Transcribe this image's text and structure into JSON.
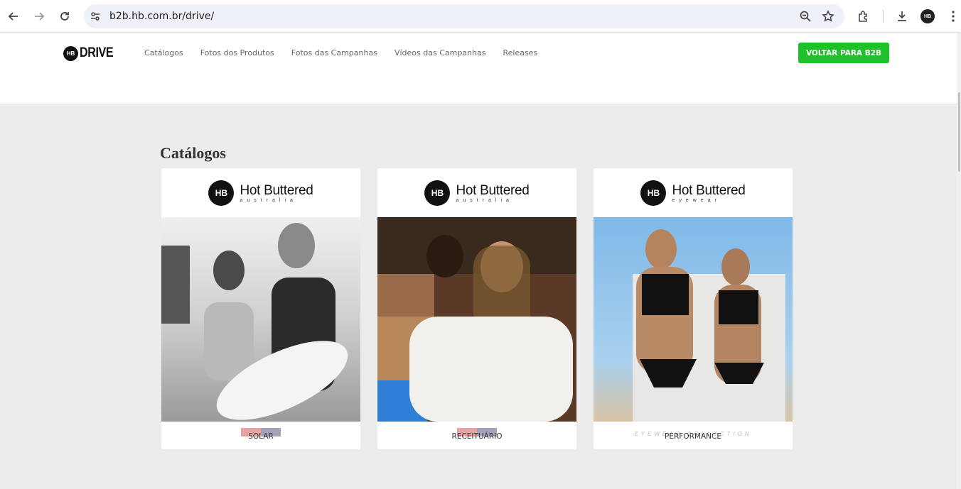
{
  "browser": {
    "url": "b2b.hb.com.br/drive/"
  },
  "header": {
    "logo_badge": "HB",
    "logo_text": "DRIVE",
    "menu": [
      {
        "label": "Catálogos"
      },
      {
        "label": "Fotos dos Produtos"
      },
      {
        "label": "Fotos das Campanhas"
      },
      {
        "label": "Vídeos das Campanhas"
      },
      {
        "label": "Releases"
      }
    ],
    "cta_label": "VOLTAR PARA B2B"
  },
  "main": {
    "section_title": "Catálogos",
    "cards": [
      {
        "brand_badge": "HB",
        "brand": "Hot Buttered",
        "brand_sub": "australia",
        "caption": "SOLAR",
        "photo_style": "bw"
      },
      {
        "brand_badge": "HB",
        "brand": "Hot Buttered",
        "brand_sub": "australia",
        "caption": "RECEITUÁRIO",
        "photo_style": "warm"
      },
      {
        "brand_badge": "HB",
        "brand": "Hot Buttered",
        "brand_sub": "eyewear",
        "caption": "PERFORMANCE",
        "photo_style": "sky",
        "overlay_text": "EYEWEAR COLLECTION"
      }
    ]
  },
  "colors": {
    "accent_green": "#1fc12a",
    "page_bg": "#ececec"
  }
}
